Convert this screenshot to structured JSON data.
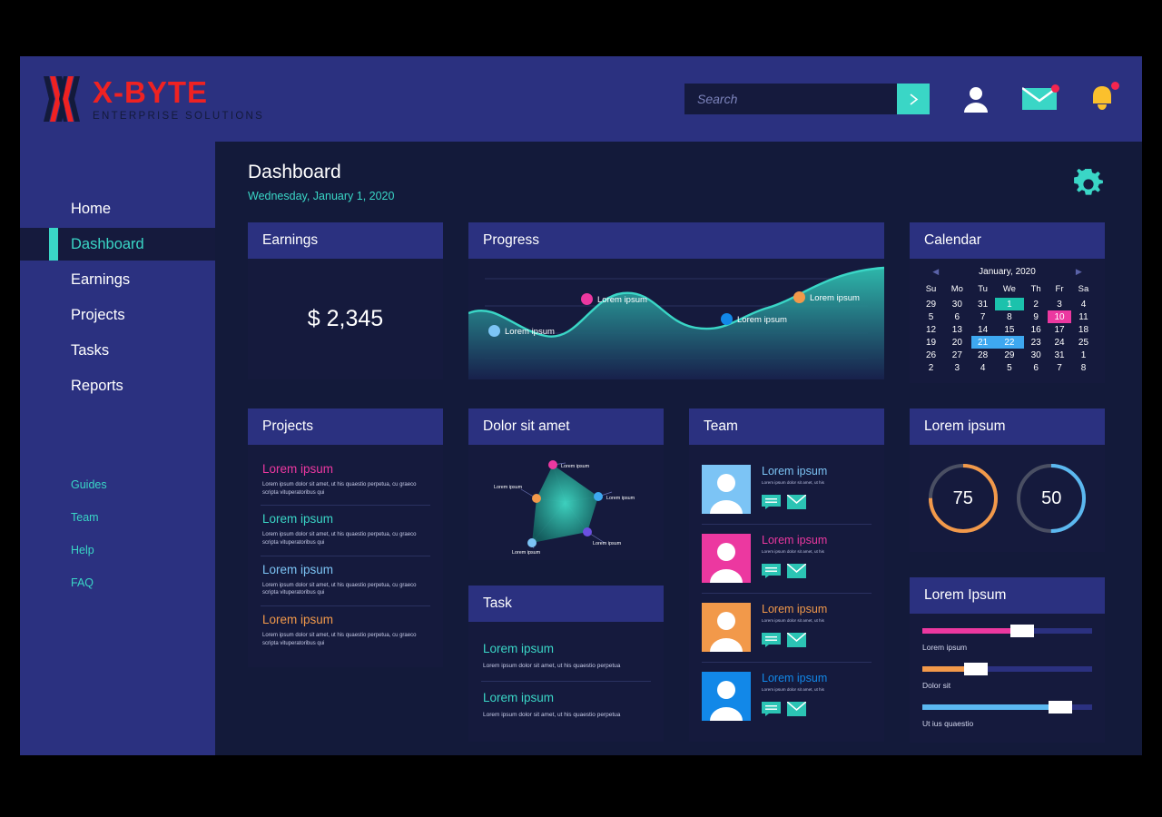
{
  "brand": {
    "name": "X-BYTE",
    "tagline": "ENTERPRISE SOLUTIONS",
    "logo_icon": "x-byte-logo-icon",
    "color_red": "#ef2222",
    "color_dark": "#131a3a"
  },
  "header": {
    "search": {
      "value": "",
      "placeholder": "Search",
      "submit_icon": "chevron-right-icon"
    },
    "icons": [
      {
        "name": "user-account-icon",
        "badge": false
      },
      {
        "name": "mail-icon",
        "badge": true
      },
      {
        "name": "notification-bell-icon",
        "badge": true
      }
    ]
  },
  "sidebar": {
    "items": [
      {
        "label": "Home",
        "active": false
      },
      {
        "label": "Dashboard",
        "active": true
      },
      {
        "label": "Earnings",
        "active": false
      },
      {
        "label": "Projects",
        "active": false
      },
      {
        "label": "Tasks",
        "active": false
      },
      {
        "label": "Reports",
        "active": false
      }
    ],
    "links": [
      {
        "label": "Guides"
      },
      {
        "label": "Team"
      },
      {
        "label": "Help"
      },
      {
        "label": "FAQ"
      }
    ]
  },
  "page": {
    "title": "Dashboard",
    "date": "Wednesday, January 1, 2020",
    "settings_icon": "gear-icon"
  },
  "cards": {
    "earnings": {
      "title": "Earnings",
      "value": "$ 2,345"
    },
    "progress": {
      "title": "Progress"
    },
    "calendar": {
      "title": "Calendar",
      "month_label": "January, 2020",
      "prev_icon": "triangle-left-icon",
      "next_icon": "triangle-right-icon",
      "weekdays": [
        "Su",
        "Mo",
        "Tu",
        "We",
        "Th",
        "Fr",
        "Sa"
      ],
      "weeks": [
        [
          {
            "d": "29",
            "s": "dim"
          },
          {
            "d": "30",
            "s": "dim"
          },
          {
            "d": "31",
            "s": "dim"
          },
          {
            "d": "1",
            "s": "hl-teal"
          },
          {
            "d": "2",
            "s": ""
          },
          {
            "d": "3",
            "s": ""
          },
          {
            "d": "4",
            "s": ""
          }
        ],
        [
          {
            "d": "5",
            "s": ""
          },
          {
            "d": "6",
            "s": ""
          },
          {
            "d": "7",
            "s": ""
          },
          {
            "d": "8",
            "s": ""
          },
          {
            "d": "9",
            "s": ""
          },
          {
            "d": "10",
            "s": "hl-pink"
          },
          {
            "d": "11",
            "s": ""
          }
        ],
        [
          {
            "d": "12",
            "s": ""
          },
          {
            "d": "13",
            "s": ""
          },
          {
            "d": "14",
            "s": ""
          },
          {
            "d": "15",
            "s": ""
          },
          {
            "d": "16",
            "s": ""
          },
          {
            "d": "17",
            "s": ""
          },
          {
            "d": "18",
            "s": ""
          }
        ],
        [
          {
            "d": "19",
            "s": ""
          },
          {
            "d": "20",
            "s": ""
          },
          {
            "d": "21",
            "s": "hl-blue"
          },
          {
            "d": "22",
            "s": "hl-blue"
          },
          {
            "d": "23",
            "s": ""
          },
          {
            "d": "24",
            "s": ""
          },
          {
            "d": "25",
            "s": ""
          }
        ],
        [
          {
            "d": "26",
            "s": ""
          },
          {
            "d": "27",
            "s": ""
          },
          {
            "d": "28",
            "s": ""
          },
          {
            "d": "29",
            "s": ""
          },
          {
            "d": "30",
            "s": ""
          },
          {
            "d": "31",
            "s": ""
          },
          {
            "d": "1",
            "s": "dim"
          }
        ],
        [
          {
            "d": "2",
            "s": "dim"
          },
          {
            "d": "3",
            "s": "dim"
          },
          {
            "d": "4",
            "s": "dim"
          },
          {
            "d": "5",
            "s": "dim"
          },
          {
            "d": "6",
            "s": "dim"
          },
          {
            "d": "7",
            "s": "dim"
          },
          {
            "d": "8",
            "s": "dim"
          }
        ]
      ]
    },
    "projects": {
      "title": "Projects",
      "items": [
        {
          "title": "Lorem ipsum",
          "color": "#ec38a0",
          "desc": "Lorem ipsum dolor sit amet, ut his quaestio perpetua, cu graeco scripta vituperatoribus qui"
        },
        {
          "title": "Lorem ipsum",
          "color": "#3ad6c6",
          "desc": "Lorem ipsum dolor sit amet, ut his quaestio perpetua, cu graeco scripta vituperatoribus qui"
        },
        {
          "title": "Lorem ipsum",
          "color": "#7cc4f5",
          "desc": "Lorem ipsum dolor sit amet, ut his quaestio perpetua, cu graeco scripta vituperatoribus qui"
        },
        {
          "title": "Lorem ipsum",
          "color": "#f2994a",
          "desc": "Lorem ipsum dolor sit amet, ut his quaestio perpetua, cu graeco scripta vituperatoribus qui"
        }
      ]
    },
    "radar": {
      "title": "Dolor sit amet"
    },
    "task": {
      "title": "Task",
      "items": [
        {
          "title": "Lorem ipsum",
          "desc": "Lorem ipsum dolor sit amet, ut his quaestio perpetua"
        },
        {
          "title": "Lorem ipsum",
          "desc": "Lorem ipsum dolor sit amet, ut his quaestio perpetua"
        }
      ]
    },
    "team": {
      "title": "Team",
      "members": [
        {
          "name": "Lorem ipsum",
          "color": "#7cc4f5",
          "sub": "Lorem ipsum dolor sit amet, ut his",
          "chat_icon": "chat-icon",
          "mail_icon": "mail-icon"
        },
        {
          "name": "Lorem ipsum",
          "color": "#ec38a0",
          "sub": "Lorem ipsum dolor sit amet, ut his",
          "chat_icon": "chat-icon",
          "mail_icon": "mail-icon"
        },
        {
          "name": "Lorem ipsum",
          "color": "#f2994a",
          "sub": "Lorem ipsum dolor sit amet, ut his",
          "chat_icon": "chat-icon",
          "mail_icon": "mail-icon"
        },
        {
          "name": "Lorem ipsum",
          "color": "#1288e8",
          "sub": "Lorem ipsum dolor sit amet, ut his",
          "chat_icon": "chat-icon",
          "mail_icon": "mail-icon"
        }
      ]
    },
    "gauges": {
      "title": "Lorem ipsum",
      "items": [
        {
          "value": "75",
          "percent": 75,
          "color": "#f2994a",
          "track": "#4a4f63"
        },
        {
          "value": "50",
          "percent": 50,
          "color": "#5bb8f0",
          "track": "#4a4f63"
        }
      ]
    },
    "sliders": {
      "title": "Lorem Ipsum",
      "items": [
        {
          "label": "Lorem ipsum",
          "percent": 55,
          "color": "#ec38a0"
        },
        {
          "label": "Dolor sit",
          "percent": 27,
          "color": "#f2994a"
        },
        {
          "label": "Ut ius quaestio",
          "percent": 83,
          "color": "#5bb8f0"
        }
      ]
    }
  },
  "chart_data": [
    {
      "type": "area",
      "title": "Progress",
      "id": "progress-wave",
      "x": [
        0,
        1,
        2,
        3,
        4,
        5,
        6,
        7
      ],
      "y": [
        62,
        40,
        30,
        58,
        74,
        56,
        48,
        88
      ],
      "ylim": [
        0,
        100
      ],
      "grid": true,
      "line_color": "#3ad6c6",
      "points": [
        {
          "label": "Lorem ipsum",
          "x": 0.85,
          "y": 35,
          "color": "#7cc4f5"
        },
        {
          "label": "Lorem ipsum",
          "x": 2.9,
          "y": 60,
          "color": "#ec38a0"
        },
        {
          "label": "Lorem ipsum",
          "x": 5.4,
          "y": 55,
          "color": "#1288e8"
        },
        {
          "label": "Lorem ipsum",
          "x": 6.9,
          "y": 76,
          "color": "#f2994a"
        }
      ]
    },
    {
      "type": "radar",
      "title": "Dolor sit amet",
      "id": "radar-chart",
      "axes": [
        "Lorem ipsum",
        "Lorem ipsum",
        "Lorem ipsum",
        "Lorem ipsum",
        "Lorem ipsum"
      ],
      "values": [
        92,
        70,
        62,
        88,
        45
      ],
      "ylim": [
        0,
        100
      ],
      "vertex_colors": [
        "#ec38a0",
        "#3ea8f0",
        "#6b4fe0",
        "#7cc4f5",
        "#f2994a"
      ],
      "fill_color": "#1a9e96"
    },
    {
      "type": "pie",
      "title": "Lorem ipsum",
      "id": "gauge-donuts",
      "categories": [
        "75",
        "50"
      ],
      "values": [
        75,
        50
      ],
      "ylim": [
        0,
        100
      ]
    },
    {
      "type": "bar",
      "title": "Lorem Ipsum",
      "id": "slider-bars",
      "categories": [
        "Lorem ipsum",
        "Dolor sit",
        "Ut ius quaestio"
      ],
      "values": [
        55,
        27,
        83
      ],
      "ylim": [
        0,
        100
      ]
    }
  ]
}
